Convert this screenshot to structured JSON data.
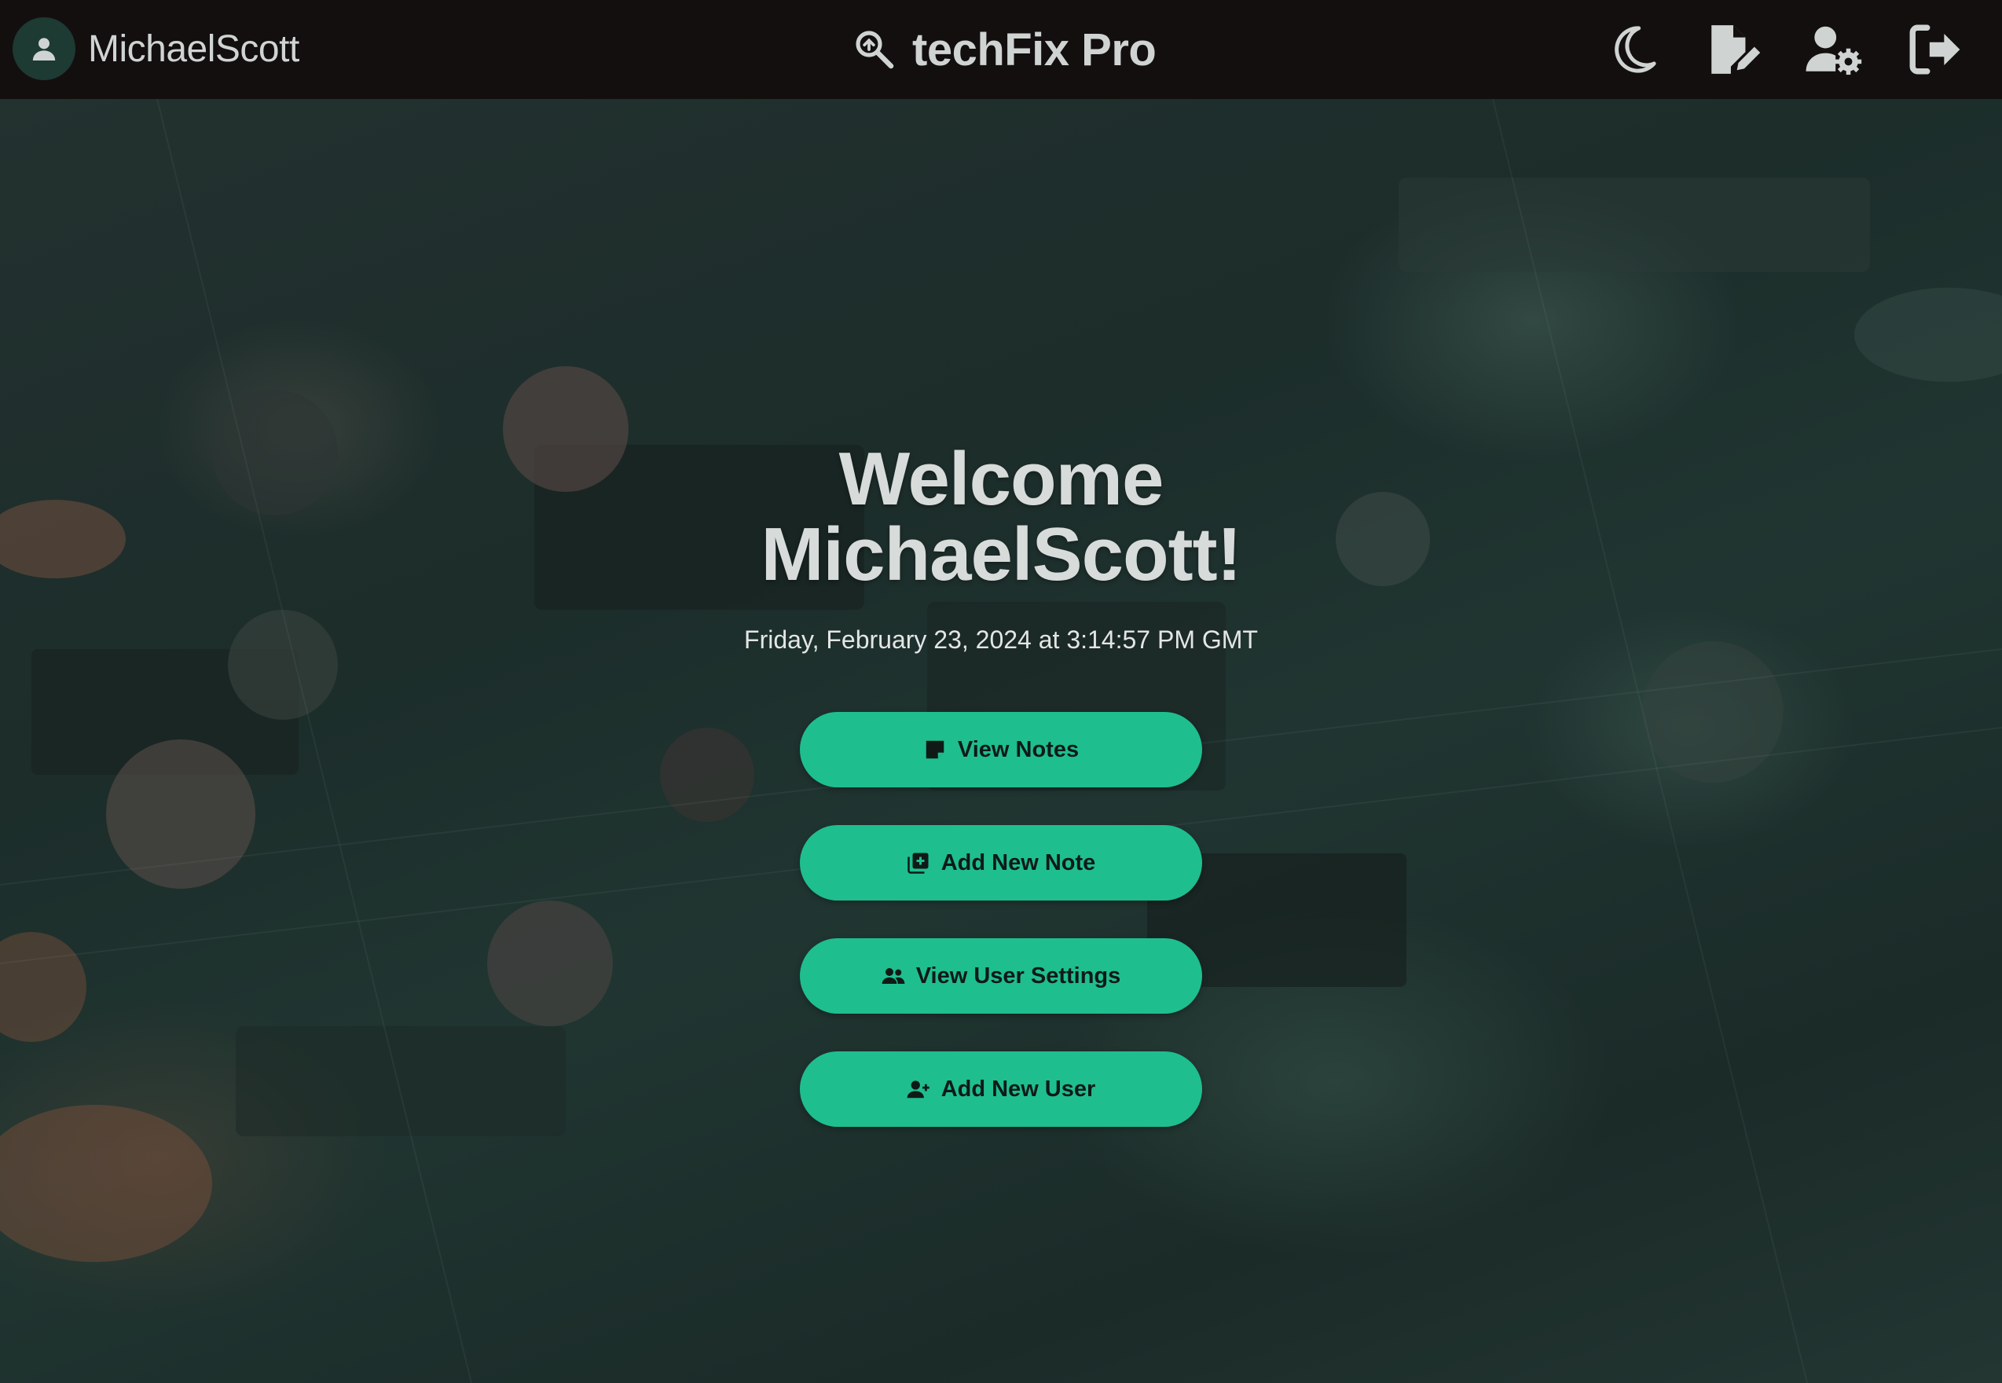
{
  "header": {
    "username": "MichaelScott",
    "brand_title": "techFix Pro",
    "avatar_icon": "user-icon",
    "brand_icon": "magnifier-wrench-icon",
    "nav_icons": [
      "moon-icon",
      "edit-document-icon",
      "user-settings-icon",
      "logout-icon"
    ]
  },
  "main": {
    "welcome_line1": "Welcome",
    "welcome_line2": "MichaelScott!",
    "datetime": "Friday, February 23, 2024 at 3:14:57 PM GMT",
    "buttons": [
      {
        "label": "View Notes",
        "icon": "note-icon"
      },
      {
        "label": "Add New Note",
        "icon": "add-note-icon"
      },
      {
        "label": "View User Settings",
        "icon": "users-icon"
      },
      {
        "label": "Add New User",
        "icon": "add-user-icon"
      }
    ]
  },
  "colors": {
    "topbar": "#140f0f",
    "accent": "#1fbe8f",
    "text_light": "#cfd4d3"
  }
}
